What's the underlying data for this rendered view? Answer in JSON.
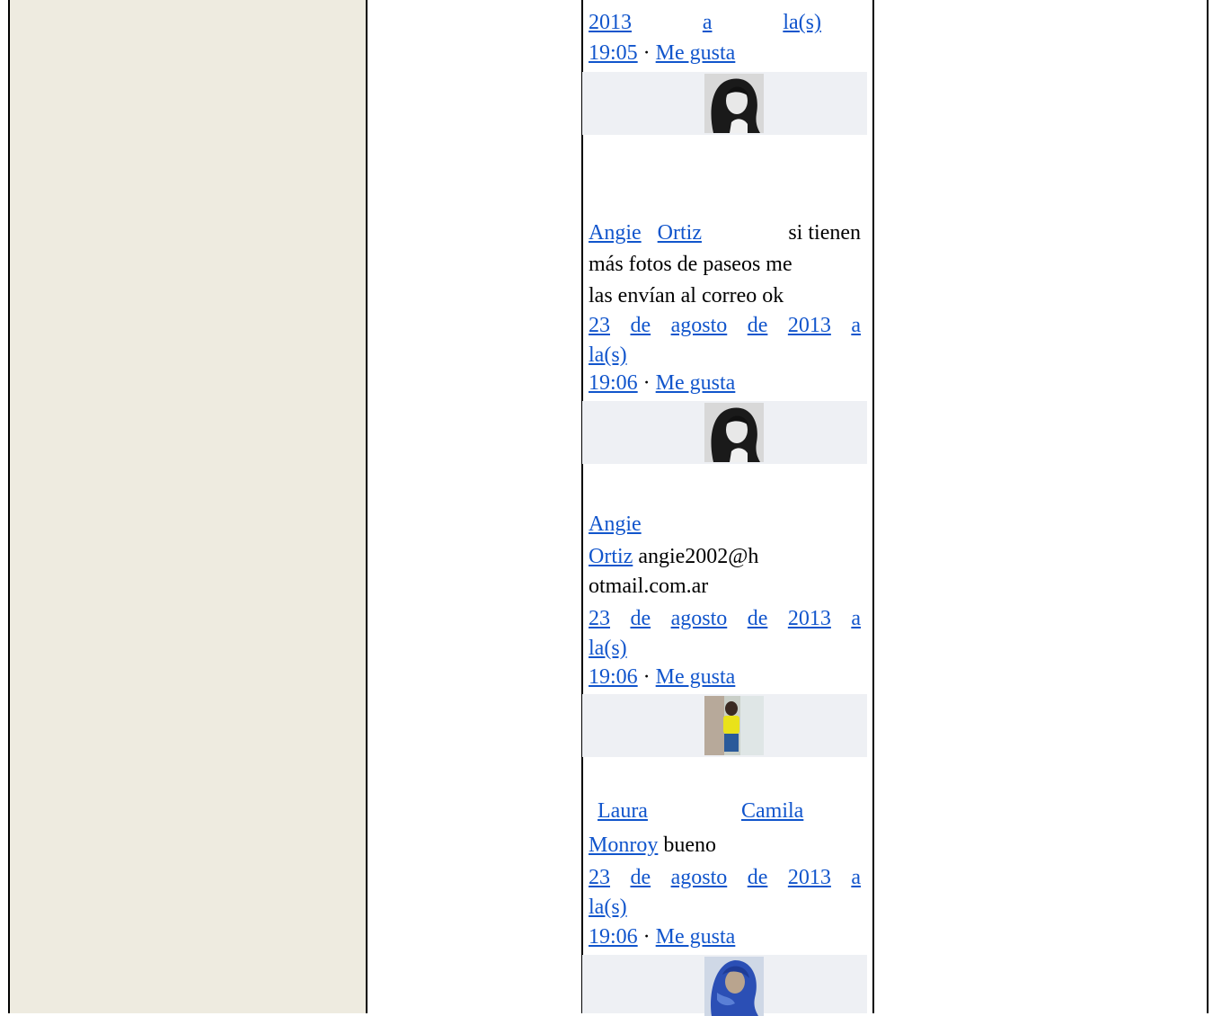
{
  "comments": [
    {
      "date_fragment": [
        "2013",
        "a",
        "la(s)"
      ],
      "time": "19:05",
      "separator": "·",
      "like": "Me gusta"
    },
    {
      "author_first": "Angie",
      "author_last": "Ortiz",
      "text_line1": "si tienen",
      "text_line2": "más fotos de paseos me",
      "text_line3": "las envían al correo ok",
      "date_words": [
        "23",
        "de",
        "agosto",
        "de",
        "2013",
        "a"
      ],
      "date_tail": "la(s)",
      "time": "19:06",
      "separator": "·",
      "like": "Me gusta"
    },
    {
      "author_first": "Angie",
      "author_last": "Ortiz",
      "text_line1": "angie2002@h",
      "text_line2": "otmail.com.ar",
      "date_words": [
        "23",
        "de",
        "agosto",
        "de",
        "2013",
        "a"
      ],
      "date_tail": "la(s)",
      "time": "19:06",
      "separator": "·",
      "like": "Me gusta"
    },
    {
      "author_first": "Laura",
      "author_middle": "Camila",
      "author_last": "Monroy",
      "text_line1": "bueno",
      "date_words": [
        "23",
        "de",
        "agosto",
        "de",
        "2013",
        "a"
      ],
      "date_tail": "la(s)",
      "time": "19:06",
      "separator": "·",
      "like": "Me gusta"
    }
  ],
  "avatars": [
    "dark-hair-portrait-icon",
    "dark-hair-portrait-icon",
    "yellow-shirt-person-icon",
    "blue-hair-portrait-icon"
  ]
}
